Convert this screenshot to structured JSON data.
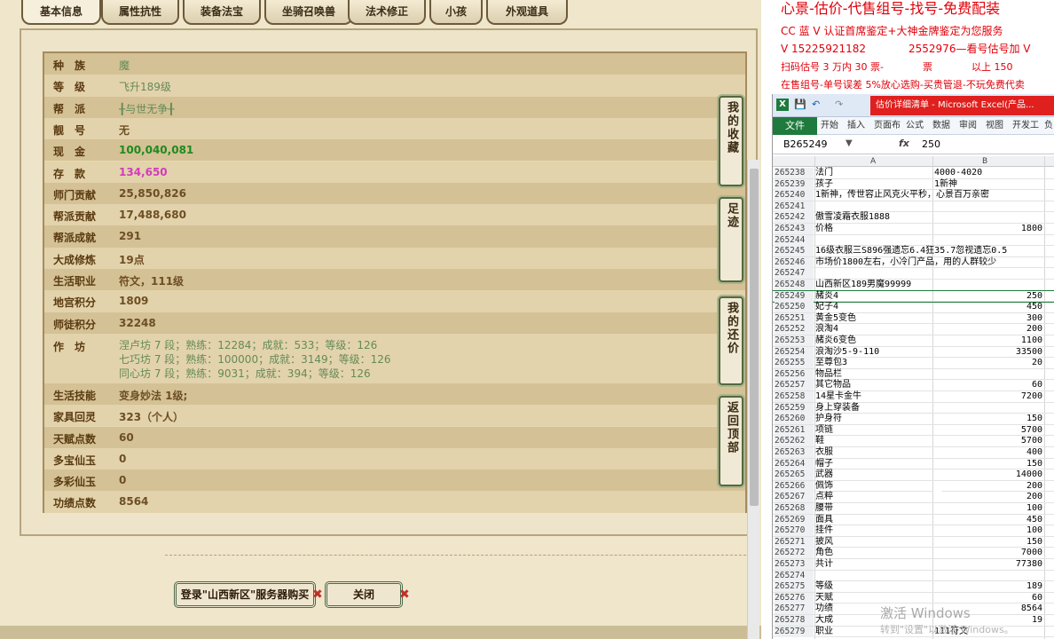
{
  "game": {
    "tabs": [
      {
        "label": "基本信息",
        "active": true
      },
      {
        "label": "属性抗性",
        "active": false
      },
      {
        "label": "装备法宝",
        "active": false
      },
      {
        "label": "坐骑召唤兽",
        "active": false
      },
      {
        "label": "法术修正",
        "active": false
      },
      {
        "label": "小孩",
        "active": false
      },
      {
        "label": "外观道具",
        "active": false
      }
    ],
    "rows": [
      {
        "label": "种　族",
        "value": "魔",
        "style": "soft"
      },
      {
        "label": "等　级",
        "value": "飞升189级",
        "style": "soft"
      },
      {
        "label": "帮　派",
        "value": "╂与世无争╂",
        "style": "soft"
      },
      {
        "label": "靓　号",
        "value": "无",
        "style": "brown"
      },
      {
        "label": "现　金",
        "value": "100,040,081",
        "style": "green"
      },
      {
        "label": "存　款",
        "value": "134,650",
        "style": "pink"
      },
      {
        "label": "师门贡献",
        "value": "25,850,826",
        "style": "brown"
      },
      {
        "label": "帮派贡献",
        "value": "17,488,680",
        "style": "brown"
      },
      {
        "label": "帮派成就",
        "value": "291",
        "style": "brown"
      },
      {
        "label": "大成修炼",
        "value": "19点",
        "style": "brown"
      },
      {
        "label": "生活职业",
        "value": "符文，111级",
        "style": "brown"
      },
      {
        "label": "地宫积分",
        "value": "1809",
        "style": "brown"
      },
      {
        "label": "师徒积分",
        "value": "32248",
        "style": "brown"
      }
    ],
    "workshop": {
      "label": "作　坊",
      "lines": [
        "涅卢坊 7 段；熟练：12284；成就：533；等级：126",
        "七巧坊 7 段；熟练：100000；成就：3149；等级：126",
        "同心坊 7 段；熟练：9031；成就：394；等级：126"
      ]
    },
    "rows2": [
      {
        "label": "生活技能",
        "value": "变身妙法 1级;",
        "style": "brown"
      },
      {
        "label": "家具回灵",
        "value": "323（个人）",
        "style": "brown"
      },
      {
        "label": "天赋点数",
        "value": "60",
        "style": "brown"
      },
      {
        "label": "多宝仙玉",
        "value": "0",
        "style": "brown"
      },
      {
        "label": "多彩仙玉",
        "value": "0",
        "style": "brown"
      },
      {
        "label": "功绩点数",
        "value": "8564",
        "style": "brown"
      }
    ],
    "side_buttons": [
      "我的收藏",
      "足迹",
      "我的还价",
      "返回顶部"
    ],
    "buy_button": "登录\"山西新区\"服务器购买",
    "close_button": "关闭"
  },
  "ads": [
    "心景-估价-代售组号-找号-免费配装",
    "CC 蓝 V 认证首席鉴定+大神金牌鉴定为您服务",
    "V 15225921182　　　　2552976—看号估号加 V",
    "扫码估号 3 万内 30 票-　　　　票　　　　以上 150",
    "在售组号-单号误差 5%放心选购-买贵管退-不玩免费代卖"
  ],
  "excel": {
    "title": "估价详细清单 - Microsoft Excel(产品...",
    "file_tab": "文件",
    "ribbon_tabs": [
      "开始",
      "插入",
      "页面布",
      "公式",
      "数据",
      "审阅",
      "视图",
      "开发工",
      "负"
    ],
    "name_box": "B265249",
    "fx": "fx",
    "formula_value": "250",
    "col_a": "A",
    "col_b": "B",
    "rows": [
      {
        "n": "265238",
        "a": "法门",
        "b": "4000-4020",
        "right": false
      },
      {
        "n": "265239",
        "a": "孩子",
        "b": "1新神",
        "right": false
      },
      {
        "n": "265240",
        "a": "1新神，传世容止风克火平秒，心景百万亲密",
        "b": "",
        "right": false
      },
      {
        "n": "265241",
        "a": "",
        "b": "",
        "right": false
      },
      {
        "n": "265242",
        "a": "傲雪凌霜衣服1888",
        "b": "",
        "right": false
      },
      {
        "n": "265243",
        "a": "价格",
        "b": "1800",
        "right": true
      },
      {
        "n": "265244",
        "a": "",
        "b": "",
        "right": false
      },
      {
        "n": "265245",
        "a": "16级衣服三S896强遗忘6.4狂35.7忽视遗忘0.5",
        "b": "",
        "right": false
      },
      {
        "n": "265246",
        "a": "市场价1800左右，小冷门产品，用的人群较少",
        "b": "",
        "right": false
      },
      {
        "n": "265247",
        "a": "",
        "b": "",
        "right": false
      },
      {
        "n": "265248",
        "a": "山西新区189男魔99999",
        "b": "",
        "right": false
      },
      {
        "n": "265249",
        "a": "赭炎4",
        "b": "250",
        "right": true
      },
      {
        "n": "265250",
        "a": "妃子4",
        "b": "450",
        "right": true
      },
      {
        "n": "265251",
        "a": "黄金5变色",
        "b": "300",
        "right": true
      },
      {
        "n": "265252",
        "a": "浪淘4",
        "b": "200",
        "right": true
      },
      {
        "n": "265253",
        "a": "赭炎6变色",
        "b": "1100",
        "right": true
      },
      {
        "n": "265254",
        "a": "浪淘沙5-9-110",
        "b": "33500",
        "right": true
      },
      {
        "n": "265255",
        "a": "至尊包3",
        "b": "20",
        "right": true
      },
      {
        "n": "265256",
        "a": "物品栏",
        "b": "",
        "right": false
      },
      {
        "n": "265257",
        "a": "其它物品",
        "b": "60",
        "right": true
      },
      {
        "n": "265258",
        "a": "14星卡金牛",
        "b": "7200",
        "right": true
      },
      {
        "n": "265259",
        "a": "身上穿装备",
        "b": "",
        "right": false
      },
      {
        "n": "265260",
        "a": "护身符",
        "b": "150",
        "right": true
      },
      {
        "n": "265261",
        "a": "项链",
        "b": "5700",
        "right": true
      },
      {
        "n": "265262",
        "a": "鞋",
        "b": "5700",
        "right": true
      },
      {
        "n": "265263",
        "a": "衣服",
        "b": "400",
        "right": true
      },
      {
        "n": "265264",
        "a": "帽子",
        "b": "150",
        "right": true
      },
      {
        "n": "265265",
        "a": "武器",
        "b": "14000",
        "right": true
      },
      {
        "n": "265266",
        "a": "佩饰",
        "b": "200",
        "right": true
      },
      {
        "n": "265267",
        "a": "点粹",
        "b": "200",
        "right": true
      },
      {
        "n": "265268",
        "a": "腰带",
        "b": "100",
        "right": true
      },
      {
        "n": "265269",
        "a": "面具",
        "b": "450",
        "right": true
      },
      {
        "n": "265270",
        "a": "挂件",
        "b": "100",
        "right": true
      },
      {
        "n": "265271",
        "a": "披风",
        "b": "150",
        "right": true
      },
      {
        "n": "265272",
        "a": "角色",
        "b": "7000",
        "right": true
      },
      {
        "n": "265273",
        "a": "共计",
        "b": "77380",
        "right": true
      },
      {
        "n": "265274",
        "a": "",
        "b": "",
        "right": false
      },
      {
        "n": "265275",
        "a": "等级",
        "b": "189",
        "right": true
      },
      {
        "n": "265276",
        "a": "天赋",
        "b": "60",
        "right": true
      },
      {
        "n": "265277",
        "a": "功绩",
        "b": "8564",
        "right": true
      },
      {
        "n": "265278",
        "a": "大成",
        "b": "19",
        "right": true
      },
      {
        "n": "265279",
        "a": "职业",
        "b": "111符文",
        "right": false
      }
    ]
  },
  "watermark": "激活 Windows",
  "watermark_sub": "转到\"设置\"以激活 Windows。"
}
